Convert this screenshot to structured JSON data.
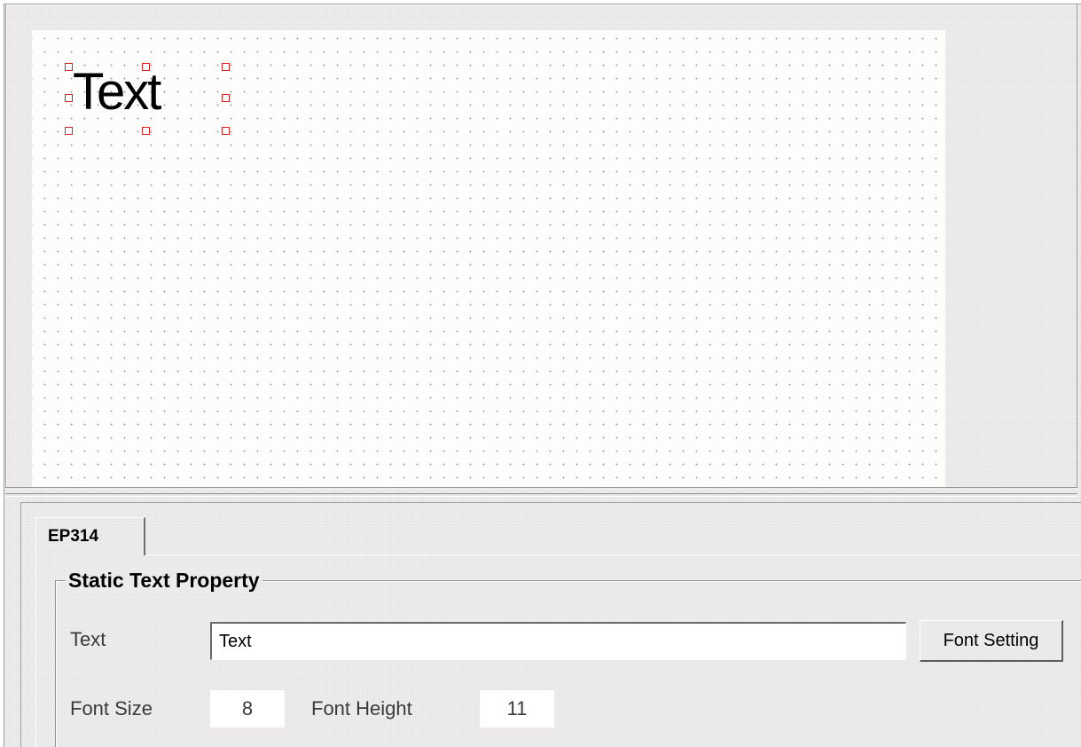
{
  "canvas": {
    "widget_text": "Text"
  },
  "tabs": [
    {
      "label": "EP314"
    }
  ],
  "properties": {
    "group_title": "Static Text Property",
    "text_label": "Text",
    "text_value": "Text",
    "font_button_label": "Font Setting",
    "font_size_label": "Font Size",
    "font_size_value": "8",
    "font_height_label": "Font Height",
    "font_height_value": "11"
  },
  "colors": {
    "selection_handle": "#e02020",
    "canvas_background": "#fdfefc",
    "window_background": "#edeaec"
  }
}
